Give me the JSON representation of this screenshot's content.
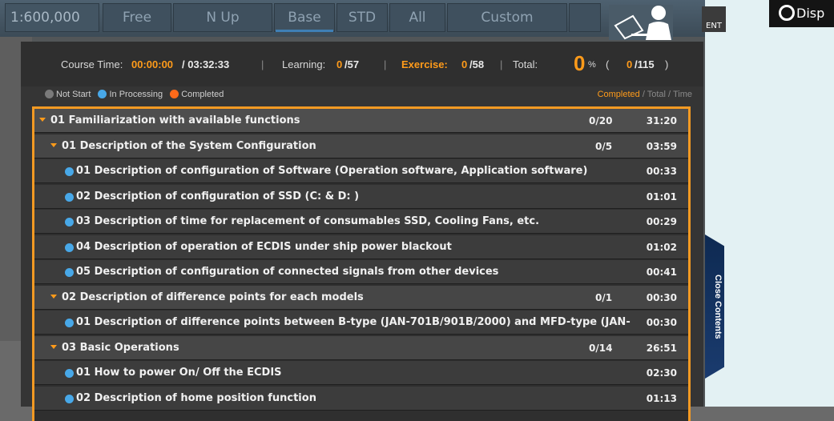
{
  "background": {
    "scale": "1:600,000",
    "toolbar": [
      "Free",
      "N Up",
      "Base",
      "STD",
      "All",
      "Custom"
    ],
    "event_label": "ENT",
    "disp_label": "Disp"
  },
  "summary": {
    "course_time_label": "Course Time:",
    "course_time_elapsed": "00:00:00",
    "course_time_total": "/ 03:32:33",
    "learning_label": "Learning:",
    "learning_done": "0",
    "learning_total": "/57",
    "exercise_label": "Exercise:",
    "exercise_done": "0",
    "exercise_total": "/58",
    "total_label": "Total:",
    "total_percent": "0",
    "percent_sign": "%",
    "paren_open": "(",
    "total_done": "0",
    "total_count": "/115",
    "paren_close": ")",
    "separator": "|"
  },
  "legend": {
    "not_start": "Not Start",
    "in_processing": "In Processing",
    "completed": "Completed",
    "right_completed": "Completed",
    "right_rest": " / Total / Time",
    "colors": {
      "not_start": "#7a7a7a",
      "in_processing": "#48a8e8",
      "completed": "#ff6a1a"
    }
  },
  "close_contents": "Close Contents",
  "rows": [
    {
      "level": 1,
      "title": "01 Familiarization with available functions",
      "count": "0/20",
      "time": "31:20"
    },
    {
      "level": 2,
      "title": "01 Description of the System Configuration",
      "count": "0/5",
      "time": "03:59"
    },
    {
      "level": 3,
      "title": "01 Description of configuration of Software (Operation software, Application software)",
      "time": "00:33"
    },
    {
      "level": 3,
      "title": "02 Description of configuration of SSD (C: & D: )",
      "time": "01:01"
    },
    {
      "level": 3,
      "title": "03 Description of time for replacement of consumables SSD, Cooling Fans, etc.",
      "time": "00:29"
    },
    {
      "level": 3,
      "title": "04 Description of operation of ECDIS under ship power blackout",
      "time": "01:02"
    },
    {
      "level": 3,
      "title": "05 Description of configuration of connected signals from other devices",
      "time": "00:41"
    },
    {
      "level": 2,
      "title": "02 Description of difference points for each models",
      "count": "0/1",
      "time": "00:30"
    },
    {
      "level": 3,
      "title": "01 Description of difference points between B-type (JAN-701B/901B/2000) and MFD-type (JAN-",
      "time": "00:30"
    },
    {
      "level": 2,
      "title": "03 Basic Operations",
      "count": "0/14",
      "time": "26:51"
    },
    {
      "level": 3,
      "title": "01 How to power On/ Off the ECDIS",
      "time": "02:30"
    },
    {
      "level": 3,
      "title": "02 Description of home position function",
      "time": "01:13"
    }
  ]
}
